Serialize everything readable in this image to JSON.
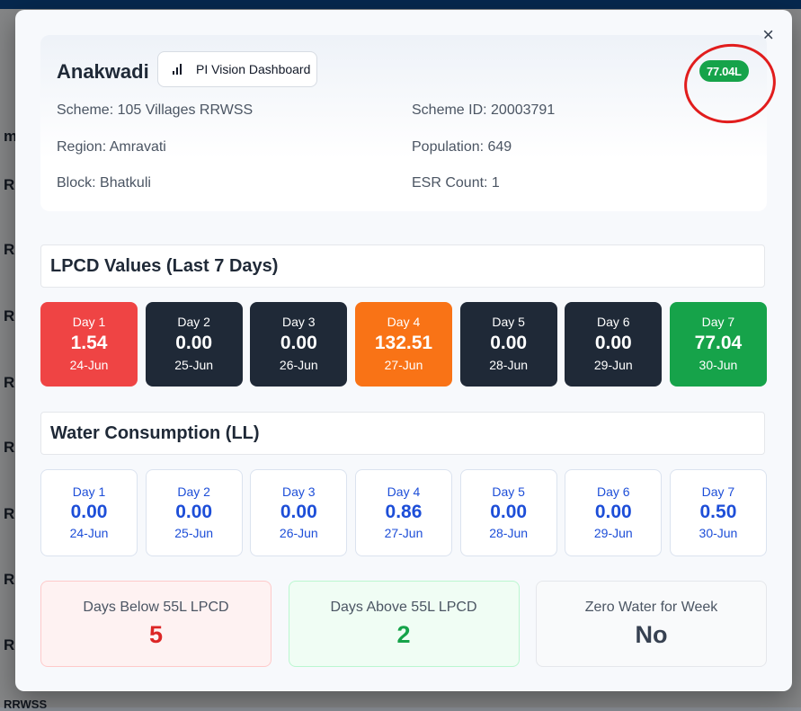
{
  "background": {
    "row_letters": [
      "m",
      "R",
      "R",
      "R",
      "R",
      "R",
      "R",
      "R",
      "R"
    ],
    "footer_text": "RRWSS"
  },
  "modal": {
    "close_glyph": "×",
    "village_name": "Anakwadi",
    "pi_button_label": "PI Vision Dashboard",
    "badge": "77.04L",
    "info": {
      "scheme": "Scheme: 105 Villages RRWSS",
      "scheme_id": "Scheme ID: 20003791",
      "region": "Region: Amravati",
      "population": "Population: 649",
      "block": "Block: Bhatkuli",
      "esr_count": "ESR Count: 1"
    },
    "lpcd": {
      "title": "LPCD Values (Last 7 Days)",
      "days": [
        {
          "label": "Day 1",
          "value": "1.54",
          "date": "24-Jun",
          "color": "#ef4444"
        },
        {
          "label": "Day 2",
          "value": "0.00",
          "date": "25-Jun",
          "color": "#1f2937"
        },
        {
          "label": "Day 3",
          "value": "0.00",
          "date": "26-Jun",
          "color": "#1f2937"
        },
        {
          "label": "Day 4",
          "value": "132.51",
          "date": "27-Jun",
          "color": "#f97316"
        },
        {
          "label": "Day 5",
          "value": "0.00",
          "date": "28-Jun",
          "color": "#1f2937"
        },
        {
          "label": "Day 6",
          "value": "0.00",
          "date": "29-Jun",
          "color": "#1f2937"
        },
        {
          "label": "Day 7",
          "value": "77.04",
          "date": "30-Jun",
          "color": "#16a34a"
        }
      ]
    },
    "water": {
      "title": "Water Consumption (LL)",
      "days": [
        {
          "label": "Day 1",
          "value": "0.00",
          "date": "24-Jun"
        },
        {
          "label": "Day 2",
          "value": "0.00",
          "date": "25-Jun"
        },
        {
          "label": "Day 3",
          "value": "0.00",
          "date": "26-Jun"
        },
        {
          "label": "Day 4",
          "value": "0.86",
          "date": "27-Jun"
        },
        {
          "label": "Day 5",
          "value": "0.00",
          "date": "28-Jun"
        },
        {
          "label": "Day 6",
          "value": "0.00",
          "date": "29-Jun"
        },
        {
          "label": "Day 7",
          "value": "0.50",
          "date": "30-Jun"
        }
      ]
    },
    "summary": [
      {
        "label": "Days Below 55L LPCD",
        "value": "5",
        "bg": "#fef2f2",
        "border": "#fecaca",
        "color": "#dc2626"
      },
      {
        "label": "Days Above 55L LPCD",
        "value": "2",
        "bg": "#f0fdf4",
        "border": "#bbf7d0",
        "color": "#16a34a"
      },
      {
        "label": "Zero Water for Week",
        "value": "No",
        "bg": "#f9fafb",
        "border": "#e5e7eb",
        "color": "#374151"
      }
    ]
  }
}
